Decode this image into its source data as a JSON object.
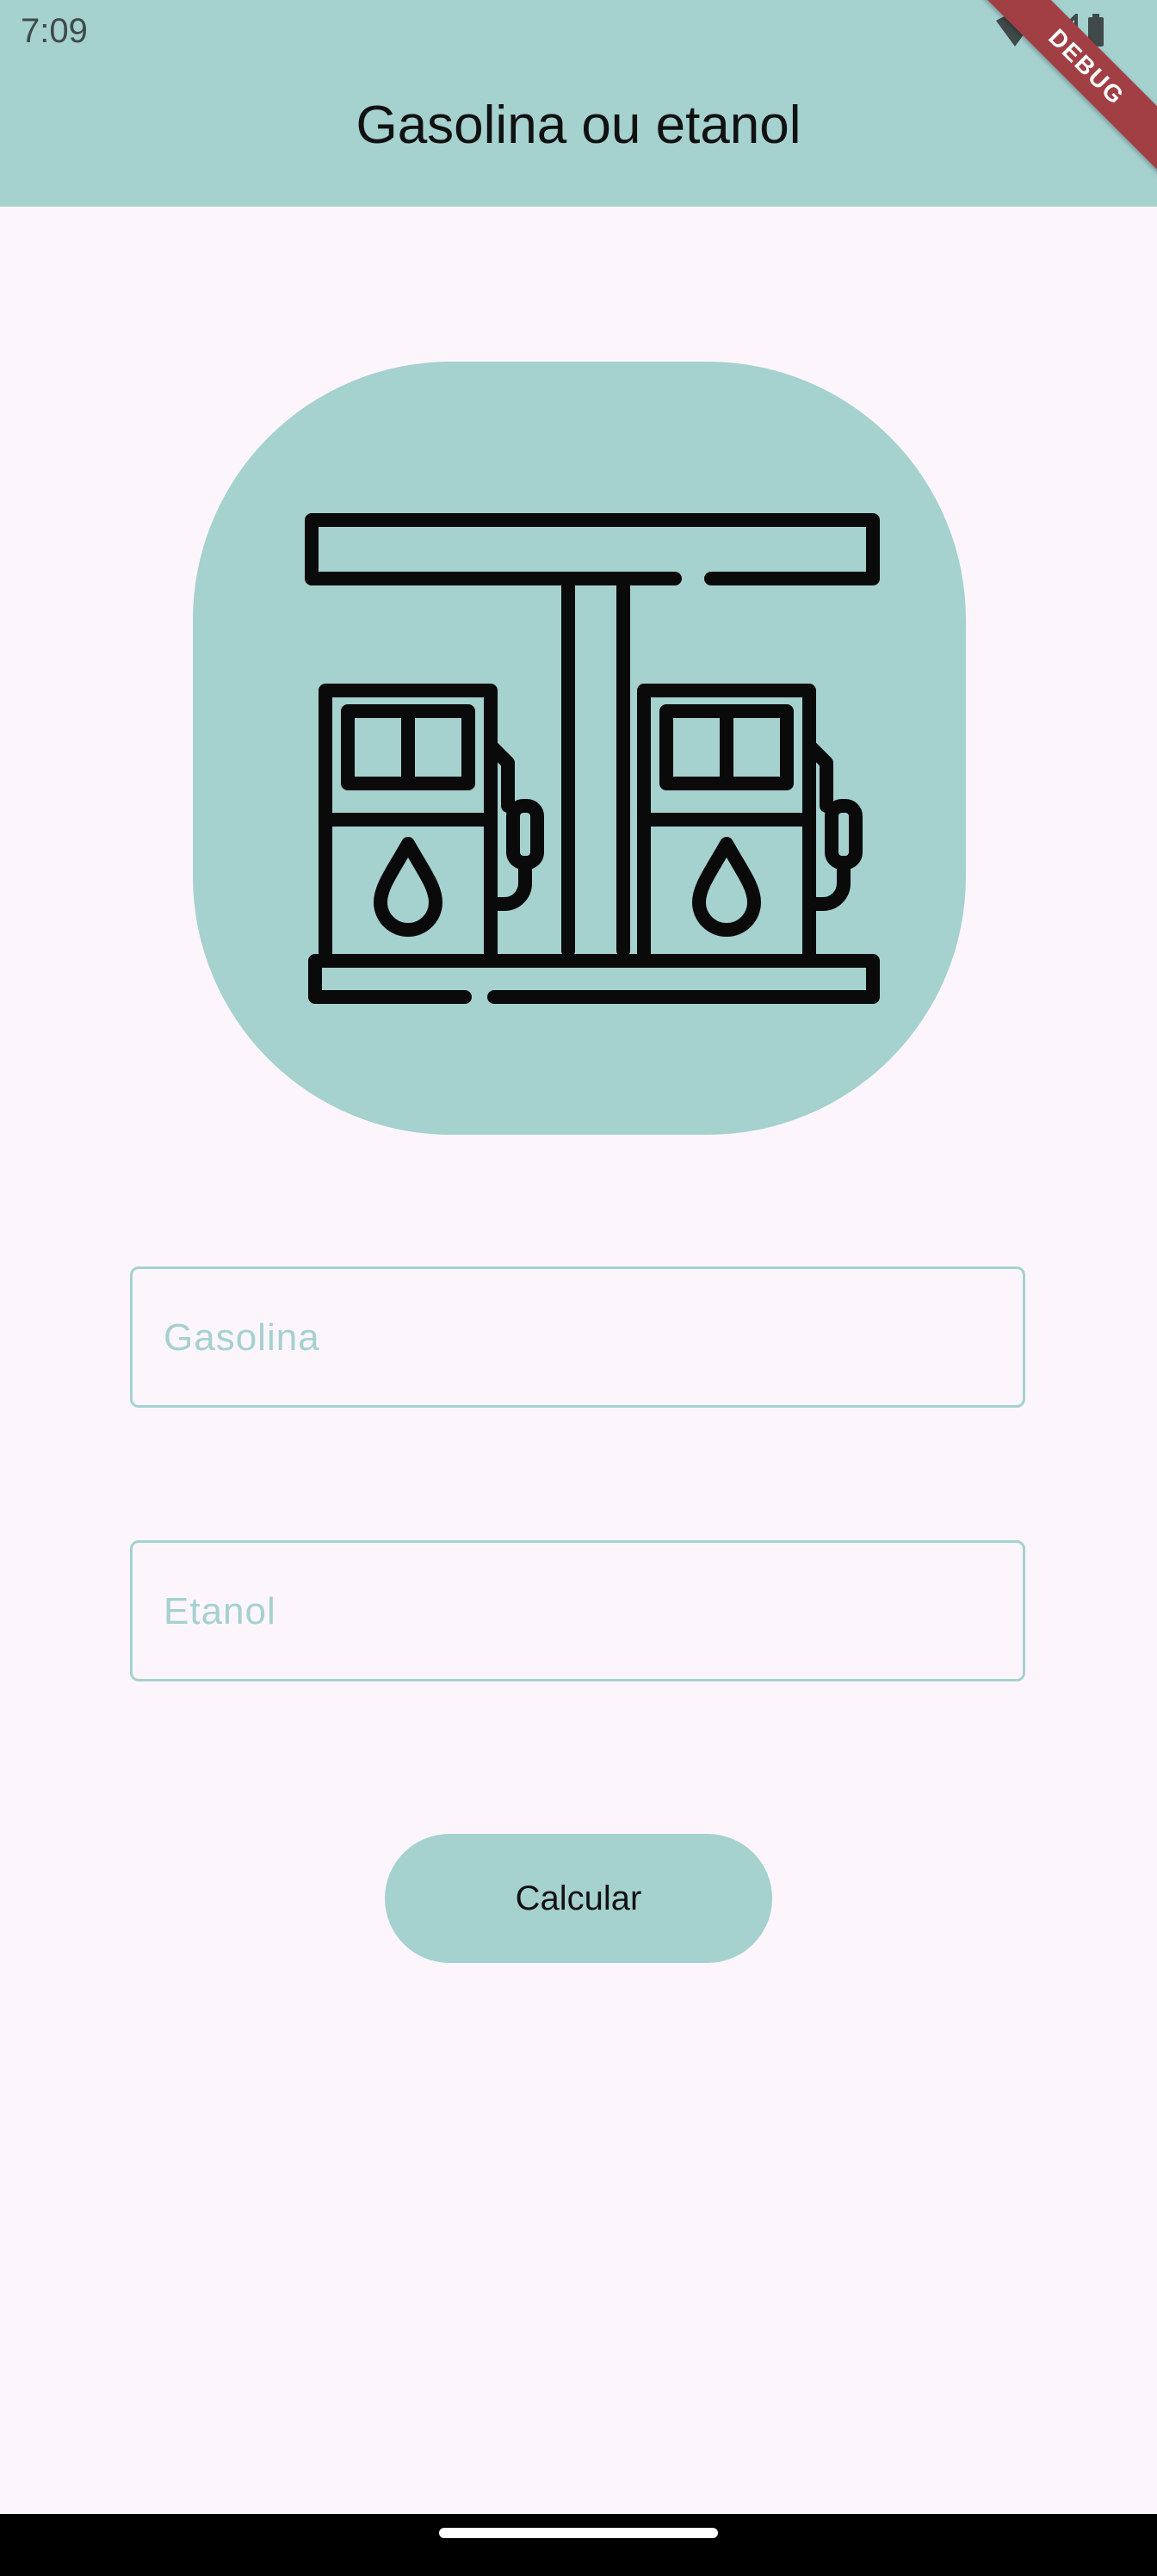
{
  "status_bar": {
    "time": "7:09",
    "icons": [
      "wifi-icon",
      "cell-signal-icon",
      "battery-icon"
    ]
  },
  "app_bar": {
    "title": "Gasolina ou etanol",
    "background": "#a5d1cf"
  },
  "debug_banner": {
    "label": "DEBUG",
    "color": "#a13f45"
  },
  "logo": {
    "icon": "gas-station-pumps-icon",
    "background": "#a5d1cf"
  },
  "form": {
    "gasolina": {
      "placeholder": "Gasolina",
      "value": ""
    },
    "etanol": {
      "placeholder": "Etanol",
      "value": ""
    },
    "calculate_label": "Calcular"
  },
  "colors": {
    "accent": "#a5d1cf",
    "page_background": "#fcf6fc"
  }
}
